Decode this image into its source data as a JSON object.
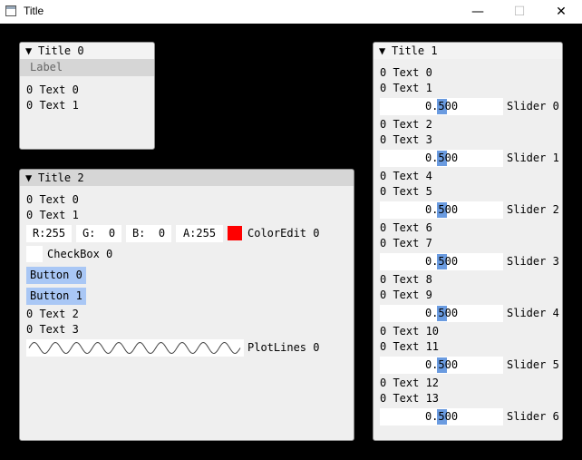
{
  "window": {
    "title": "Title",
    "minimize": "—",
    "maximize": "☐",
    "close": "✕"
  },
  "panel0": {
    "title": "Title 0",
    "label": "Label",
    "texts": [
      "0 Text 0",
      "0 Text 1"
    ]
  },
  "panel2": {
    "title": "Title 2",
    "texts_top": [
      "0 Text 0",
      "0 Text 1"
    ],
    "color": {
      "r": "R:255",
      "g": "G:  0",
      "b": "B:  0",
      "a": "A:255",
      "label": "ColorEdit 0",
      "value": "#ff0000"
    },
    "checkbox_label": "CheckBox 0",
    "buttons": [
      "Button 0",
      "Button 1"
    ],
    "texts_bottom": [
      "0 Text 2",
      "0 Text 3"
    ],
    "plot_label": "PlotLines 0"
  },
  "panel1": {
    "title": "Title 1",
    "groups": [
      {
        "t1": "0 Text 0",
        "t2": "0 Text 1",
        "value": "0.500",
        "label": "Slider 0"
      },
      {
        "t1": "0 Text 2",
        "t2": "0 Text 3",
        "value": "0.500",
        "label": "Slider 1"
      },
      {
        "t1": "0 Text 4",
        "t2": "0 Text 5",
        "value": "0.500",
        "label": "Slider 2"
      },
      {
        "t1": "0 Text 6",
        "t2": "0 Text 7",
        "value": "0.500",
        "label": "Slider 3"
      },
      {
        "t1": "0 Text 8",
        "t2": "0 Text 9",
        "value": "0.500",
        "label": "Slider 4"
      },
      {
        "t1": "0 Text 10",
        "t2": "0 Text 11",
        "value": "0.500",
        "label": "Slider 5"
      },
      {
        "t1": "0 Text 12",
        "t2": "0 Text 13",
        "value": "0.500",
        "label": "Slider 6"
      }
    ]
  },
  "icons": {
    "collapse": "▼"
  },
  "colors": {
    "grab": "#6a9be0",
    "button": "#a9c7f5",
    "color_value": "#ff0000"
  }
}
